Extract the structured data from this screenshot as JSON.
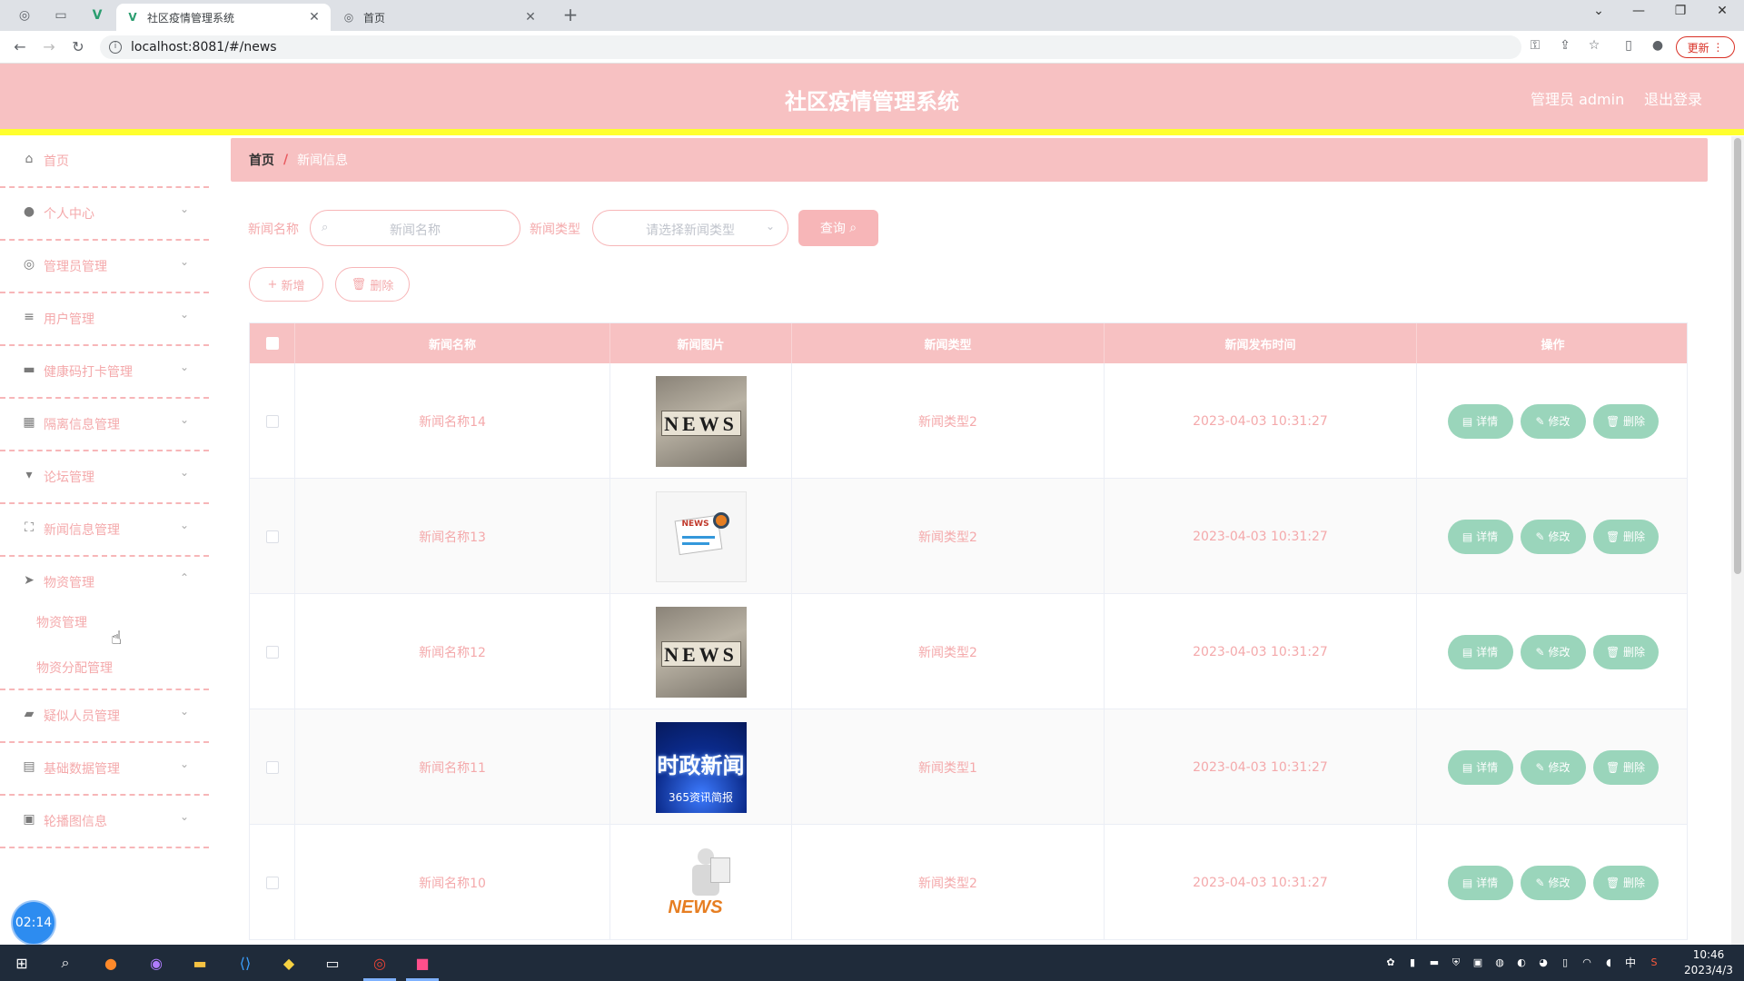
{
  "browser": {
    "tabs": [
      {
        "title": "社区疫情管理系统",
        "active": true
      },
      {
        "title": "首页",
        "active": false
      }
    ],
    "url": "localhost:8081/#/news",
    "update_label": "更新"
  },
  "header": {
    "title": "社区疫情管理系统",
    "user": "管理员 admin",
    "logout": "退出登录"
  },
  "sidebar": {
    "items": [
      {
        "label": "首页",
        "icon": "home-icon"
      },
      {
        "label": "个人中心",
        "icon": "user-icon"
      },
      {
        "label": "管理员管理",
        "icon": "settings-icon"
      },
      {
        "label": "用户管理",
        "icon": "sliders-icon"
      },
      {
        "label": "健康码打卡管理",
        "icon": "briefcase-icon"
      },
      {
        "label": "隔离信息管理",
        "icon": "grid-icon"
      },
      {
        "label": "论坛管理",
        "icon": "cup-icon"
      },
      {
        "label": "新闻信息管理",
        "icon": "fullscreen-icon"
      },
      {
        "label": "物资管理",
        "icon": "send-icon"
      },
      {
        "label": "疑似人员管理",
        "icon": "ticket-icon"
      },
      {
        "label": "基础数据管理",
        "icon": "printer-icon"
      },
      {
        "label": "轮播图信息",
        "icon": "clipboard-icon"
      }
    ],
    "sub_items": [
      "物资管理",
      "物资分配管理"
    ],
    "timer": "02:14"
  },
  "breadcrumb": {
    "home": "首页",
    "sep": "/",
    "current": "新闻信息"
  },
  "search": {
    "name_label": "新闻名称",
    "name_placeholder": "新闻名称",
    "type_label": "新闻类型",
    "type_placeholder": "请选择新闻类型",
    "query_label": "查询"
  },
  "actions": {
    "add_label": "新增",
    "delete_label": "删除"
  },
  "table": {
    "columns": [
      "新闻名称",
      "新闻图片",
      "新闻类型",
      "新闻发布时间",
      "操作"
    ],
    "rows": [
      {
        "name": "新闻名称14",
        "image": "news-blocks",
        "type": "新闻类型2",
        "time": "2023-04-03 10:31:27"
      },
      {
        "name": "新闻名称13",
        "image": "news-paper",
        "type": "新闻类型2",
        "time": "2023-04-03 10:31:27"
      },
      {
        "name": "新闻名称12",
        "image": "news-blocks",
        "type": "新闻类型2",
        "time": "2023-04-03 10:31:27"
      },
      {
        "name": "新闻名称11",
        "image": "news-political",
        "type": "新闻类型1",
        "time": "2023-04-03 10:31:27"
      },
      {
        "name": "新闻名称10",
        "image": "news-figure",
        "type": "新闻类型2",
        "time": "2023-04-03 10:31:27"
      }
    ],
    "op_labels": {
      "detail": "详情",
      "edit": "修改",
      "delete": "删除"
    },
    "thumb_texts": {
      "blocks": "NEWS",
      "paper": "NEWS",
      "political_title": "时政新闻",
      "political_sub": "365资讯简报",
      "figure": "NEWS"
    }
  },
  "taskbar": {
    "time": "10:46",
    "date": "2023/4/3",
    "ime": "中"
  },
  "colors": {
    "header": "#f7c1c2",
    "accent_text": "#f4a9ab",
    "op_button": "#9ad5bb",
    "strip": "#ffff2e"
  }
}
